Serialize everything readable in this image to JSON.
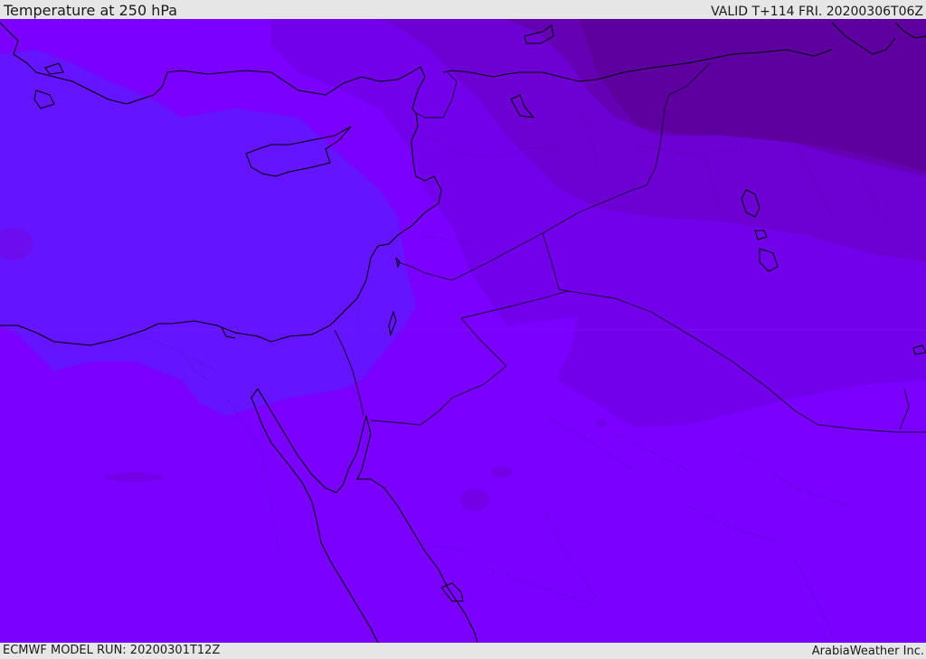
{
  "header": {
    "title": "Temperature at 250 hPa",
    "valid": "VALID T+114 FRI. 20200306T06Z"
  },
  "footer": {
    "model_run": "ECMWF MODEL RUN: 20200301T12Z",
    "credit": "ArabiaWeather Inc."
  },
  "colors": {
    "band_warmest": "#7a00ff",
    "band_cold_blue": "#6414ff",
    "band_1": "#7200ea",
    "band_2": "#6d00d2",
    "band_3": "#6500b4",
    "band_4": "#5e009f",
    "coastline": "#000000",
    "border": "#1a0033",
    "frame": "#e6e6e6"
  }
}
